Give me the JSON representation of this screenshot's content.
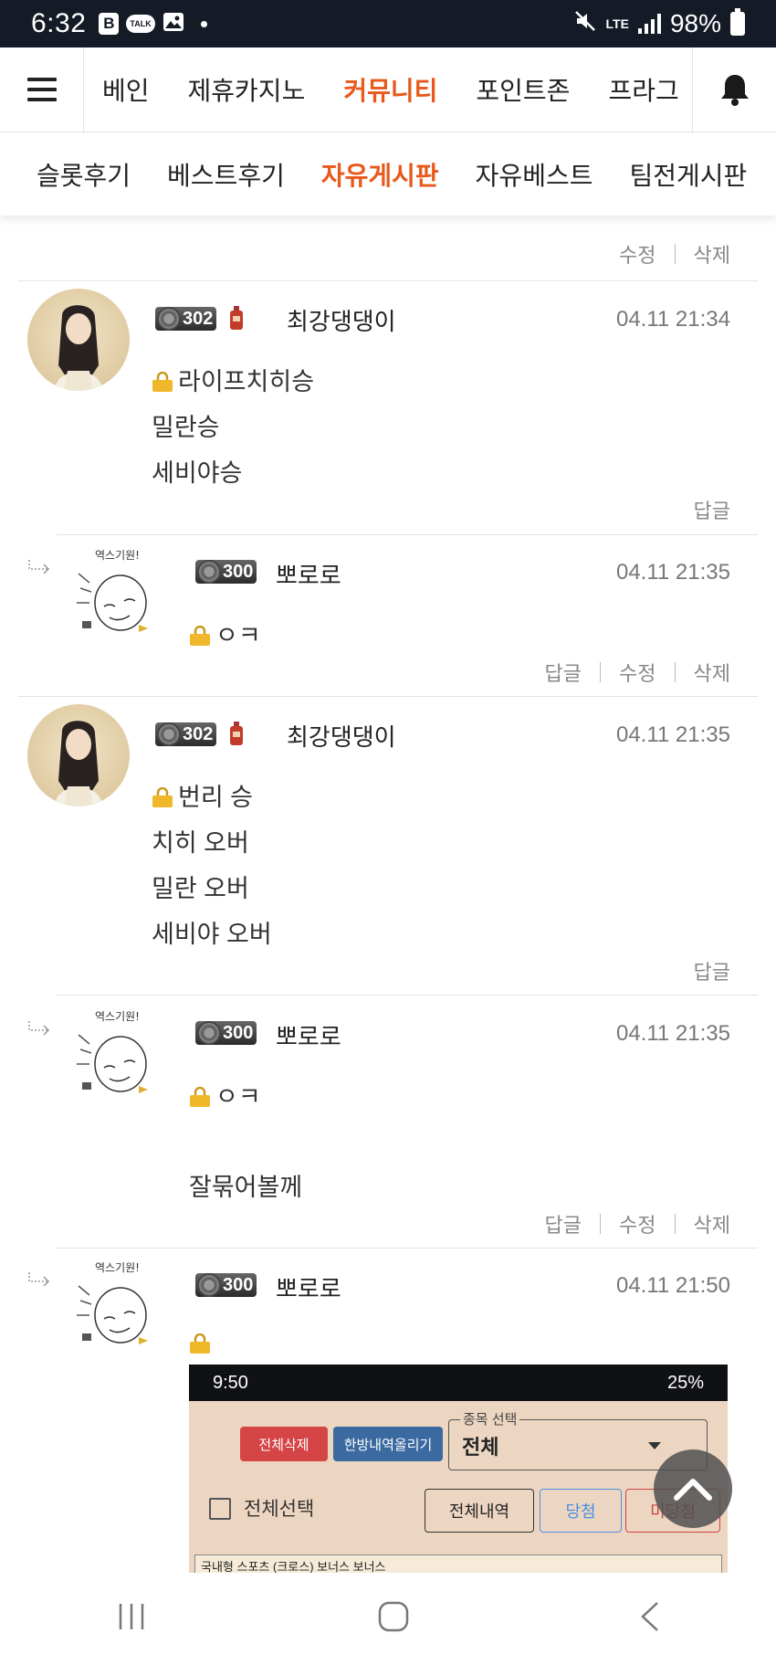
{
  "status_bar": {
    "time": "6:32",
    "b_icon": "B",
    "talk_label": "TALK",
    "network": "LTE",
    "battery": "98%"
  },
  "main_nav": {
    "items": [
      "베인",
      "제휴카지노",
      "커뮤니티",
      "포인트존",
      "프라그"
    ],
    "active_index": 2
  },
  "sub_nav": {
    "items": [
      "슬롯후기",
      "베스트후기",
      "자유게시판",
      "자유베스트",
      "팀전게시판"
    ],
    "active_index": 2
  },
  "top_actions": {
    "edit": "수정",
    "delete": "삭제"
  },
  "comments": [
    {
      "level": "302",
      "nickname": "최강댕댕이",
      "date": "04.11 21:34",
      "lines": [
        "라이프치히승",
        "밀란승",
        "세비야승"
      ],
      "actions": [
        "답글"
      ]
    },
    {
      "level": "300",
      "nickname": "뽀로로",
      "avatar_text": "역스기원!",
      "date": "04.11 21:35",
      "lines": [
        "ㅇㅋ"
      ],
      "actions": [
        "답글",
        "수정",
        "삭제"
      ]
    },
    {
      "level": "302",
      "nickname": "최강댕댕이",
      "date": "04.11 21:35",
      "lines": [
        "번리 승",
        "치히 오버",
        "밀란 오버",
        "세비야 오버"
      ],
      "actions": [
        "답글"
      ]
    },
    {
      "level": "300",
      "nickname": "뽀로로",
      "avatar_text": "역스기원!",
      "date": "04.11 21:35",
      "lines": [
        "ㅇㅋ",
        "잘묶어볼께"
      ],
      "actions": [
        "답글",
        "수정",
        "삭제"
      ]
    },
    {
      "level": "300",
      "nickname": "뽀로로",
      "avatar_text": "역스기원!",
      "date": "04.11 21:50",
      "lines": [],
      "actions": []
    }
  ],
  "embedded_screenshot": {
    "time": "9:50",
    "battery": "25%",
    "delete_all": "전체삭제",
    "upload": "한방내역올리기",
    "select_label": "종목 선택",
    "select_value": "전체",
    "select_all": "전체선택",
    "tab_all": "전체내역",
    "tab_win": "당첨",
    "tab_lose": "미당첨",
    "row_text": "국내형 스포츠 (크로스) 보너스 보너스"
  },
  "colors": {
    "accent": "#e8591c",
    "status_bar_bg": "#141a26",
    "text": "#222222",
    "meta": "#777777"
  },
  "icons": [
    "menu-icon",
    "bell-icon",
    "lock-icon",
    "reply-arrow-icon",
    "chevron-up-icon",
    "recent-apps-icon",
    "home-icon",
    "back-icon"
  ]
}
